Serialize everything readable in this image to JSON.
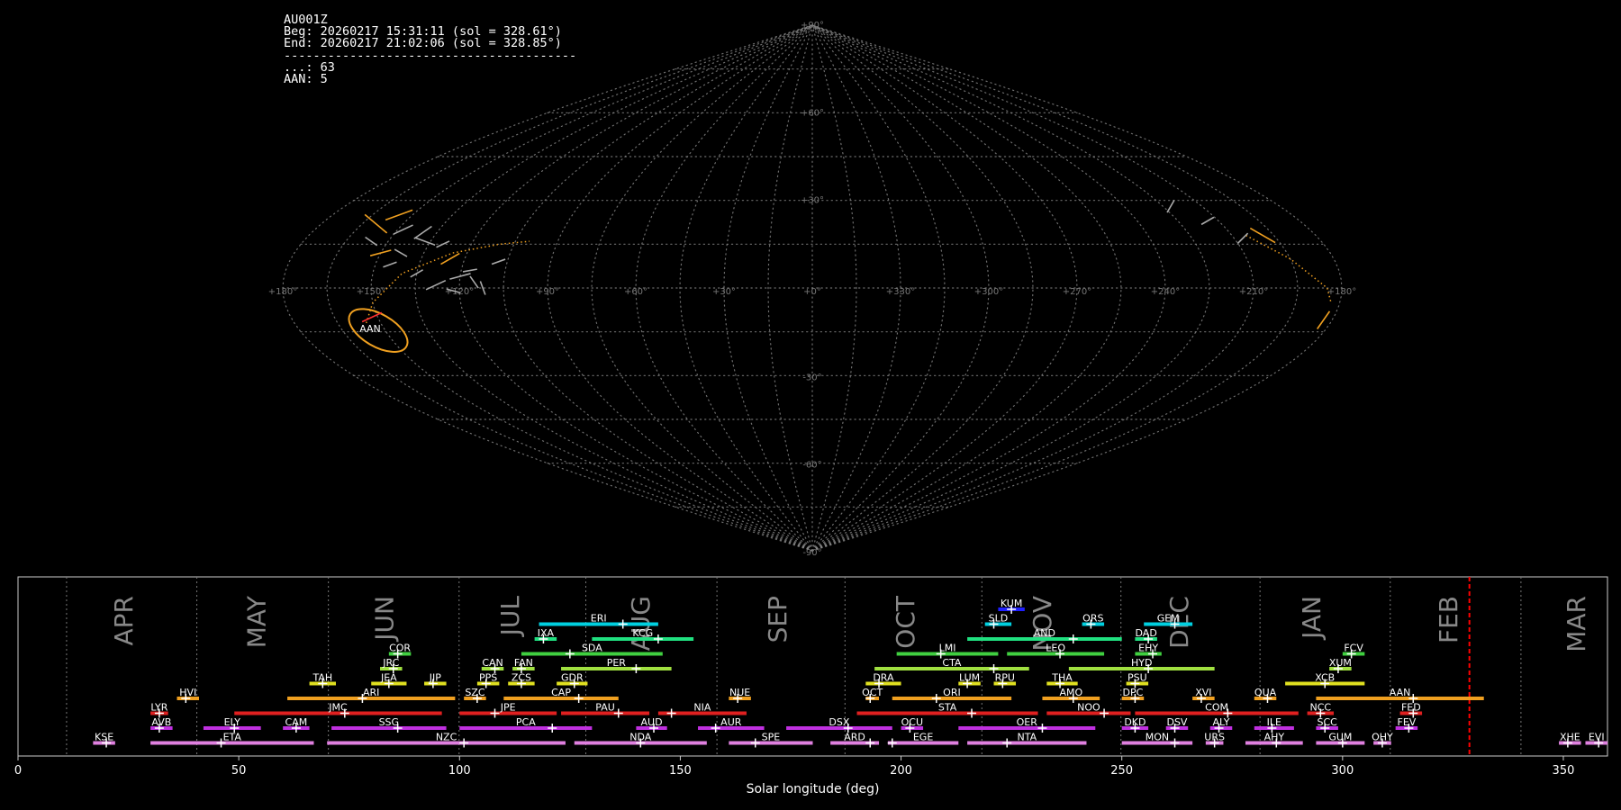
{
  "header": {
    "station": "AU001Z",
    "beg": "Beg: 20260217 15:31:11 (sol = 328.61°)",
    "end": "End: 20260217 21:02:06 (sol = 328.85°)",
    "divider": "----------------------------------------",
    "sporadic": "...: 63",
    "shower_count": "AAN: 5"
  },
  "colors": {
    "background": "#000000",
    "grid": "#888888",
    "orbit": "#f0a020",
    "sol_marker": "#ff0000"
  },
  "chart_data": [
    {
      "type": "scatter",
      "projection": "sinusoidal",
      "lon_labels": [
        "+180°",
        "+150°",
        "+120°",
        "+90°",
        "+60°",
        "+30°",
        "+0°",
        "+330°",
        "+300°",
        "+270°",
        "+240°",
        "+210°",
        "+180°"
      ],
      "lat_labels": [
        "+90°",
        "+60°",
        "+30°",
        "-30°",
        "-60°",
        "-90°"
      ],
      "annotations": [
        "AAN"
      ],
      "radiants": [
        {
          "lon": 155,
          "lat": 25,
          "len": 4,
          "ang": 20,
          "color": "#f0a020"
        },
        {
          "lon": 160,
          "lat": 22,
          "len": 4,
          "ang": -40,
          "color": "#f0a020"
        },
        {
          "lon": 150,
          "lat": 12,
          "len": 3,
          "ang": 15,
          "color": "#f0a020"
        },
        {
          "lon": 125,
          "lat": 10,
          "len": 3,
          "ang": 30,
          "color": "#f0a020"
        },
        {
          "lon": 148,
          "lat": 20,
          "len": 3,
          "ang": 25,
          "color": "#aaaaaa"
        },
        {
          "lon": 140,
          "lat": 19,
          "len": 3,
          "ang": 35,
          "color": "#aaaaaa"
        },
        {
          "lon": 137,
          "lat": 16,
          "len": 3,
          "ang": -20,
          "color": "#aaaaaa"
        },
        {
          "lon": 130,
          "lat": 15,
          "len": 2,
          "ang": 25,
          "color": "#aaaaaa"
        },
        {
          "lon": 156,
          "lat": 16,
          "len": 2,
          "ang": -35,
          "color": "#aaaaaa"
        },
        {
          "lon": 145,
          "lat": 8,
          "len": 2,
          "ang": 20,
          "color": "#aaaaaa"
        },
        {
          "lon": 120,
          "lat": 4,
          "len": 3,
          "ang": 15,
          "color": "#aaaaaa"
        },
        {
          "lon": 128,
          "lat": 1,
          "len": 3,
          "ang": 25,
          "color": "#aaaaaa"
        },
        {
          "lon": 122,
          "lat": -1,
          "len": 2,
          "ang": -15,
          "color": "#aaaaaa"
        },
        {
          "lon": 115,
          "lat": 2,
          "len": 2,
          "ang": -55,
          "color": "#aaaaaa"
        },
        {
          "lon": 135,
          "lat": 5,
          "len": 2,
          "ang": 30,
          "color": "#aaaaaa"
        },
        {
          "lon": 117,
          "lat": 6,
          "len": 2,
          "ang": 10,
          "color": "#aaaaaa"
        },
        {
          "lon": 112,
          "lat": 0,
          "len": 2,
          "ang": -70,
          "color": "#aaaaaa"
        },
        {
          "lon": 108,
          "lat": 9,
          "len": 2,
          "ang": 20,
          "color": "#aaaaaa"
        },
        {
          "lon": 143,
          "lat": 12,
          "len": 2,
          "ang": -30,
          "color": "#aaaaaa"
        },
        {
          "lon": 152,
          "lat": -10,
          "len": 3,
          "ang": 25,
          "color": "#ff3030"
        },
        {
          "lon": 199,
          "lat": 18,
          "len": 4,
          "ang": -30,
          "color": "#f0a020"
        },
        {
          "lon": 183,
          "lat": -11,
          "len": 3,
          "ang": 55,
          "color": "#f0a020"
        },
        {
          "lon": 207,
          "lat": 17,
          "len": 2,
          "ang": 45,
          "color": "#aaaaaa"
        },
        {
          "lon": 214,
          "lat": 23,
          "len": 2,
          "ang": 30,
          "color": "#aaaaaa"
        },
        {
          "lon": 222,
          "lat": 28,
          "len": 2,
          "ang": 60,
          "color": "#aaaaaa"
        }
      ]
    },
    {
      "type": "bar",
      "xlabel": "Solar longitude (deg)",
      "xlim": [
        0,
        360
      ],
      "xticks": [
        0,
        50,
        100,
        150,
        200,
        250,
        300,
        350
      ],
      "month_boundaries": [
        11,
        40.5,
        70.3,
        99.9,
        128.6,
        158.3,
        187.3,
        218.3,
        249.8,
        281.3,
        310.8,
        340.4
      ],
      "months": [
        {
          "label": "APR",
          "x": 24
        },
        {
          "label": "MAY",
          "x": 54
        },
        {
          "label": "JUN",
          "x": 83
        },
        {
          "label": "JUL",
          "x": 111.5
        },
        {
          "label": "AUG",
          "x": 141
        },
        {
          "label": "SEP",
          "x": 172
        },
        {
          "label": "OCT",
          "x": 201
        },
        {
          "label": "NOV",
          "x": 232
        },
        {
          "label": "DEC",
          "x": 263
        },
        {
          "label": "JAN",
          "x": 293
        },
        {
          "label": "FEB",
          "x": 324
        },
        {
          "label": "MAR",
          "x": 353
        }
      ],
      "current_sol": 328.73,
      "showers": [
        {
          "code": "KUM",
          "start": 222,
          "end": 228,
          "peak": 225,
          "row": 10,
          "color": "#2020ff"
        },
        {
          "code": "ERI",
          "start": 118,
          "end": 145,
          "peak": 137,
          "row": 9,
          "color": "#00d0e0"
        },
        {
          "code": "SLD",
          "start": 219,
          "end": 225,
          "peak": 221,
          "row": 9,
          "color": "#00d0e0"
        },
        {
          "code": "ORS",
          "start": 241,
          "end": 246,
          "peak": 243,
          "row": 9,
          "color": "#00d0e0"
        },
        {
          "code": "GEM",
          "start": 255,
          "end": 266,
          "peak": 262,
          "row": 9,
          "color": "#00d0e0"
        },
        {
          "code": "IXA",
          "start": 117,
          "end": 122,
          "peak": 119,
          "row": 8,
          "color": "#20e080"
        },
        {
          "code": "KCG",
          "start": 130,
          "end": 153,
          "peak": 145,
          "row": 8,
          "color": "#20e080"
        },
        {
          "code": "AND",
          "start": 215,
          "end": 250,
          "peak": 239,
          "row": 8,
          "color": "#20e080"
        },
        {
          "code": "DAD",
          "start": 253,
          "end": 258,
          "peak": 256,
          "row": 8,
          "color": "#20e080"
        },
        {
          "code": "COR",
          "start": 84,
          "end": 89,
          "peak": 86,
          "row": 7,
          "color": "#40d040"
        },
        {
          "code": "SDA",
          "start": 114,
          "end": 146,
          "peak": 125,
          "row": 7,
          "color": "#40d040"
        },
        {
          "code": "LMI",
          "start": 199,
          "end": 222,
          "peak": 209,
          "row": 7,
          "color": "#40d040"
        },
        {
          "code": "LEO",
          "start": 224,
          "end": 246,
          "peak": 236,
          "row": 7,
          "color": "#40d040"
        },
        {
          "code": "EHY",
          "start": 253,
          "end": 259,
          "peak": 257,
          "row": 7,
          "color": "#40d040"
        },
        {
          "code": "FCV",
          "start": 300,
          "end": 305,
          "peak": 302,
          "row": 7,
          "color": "#40d040"
        },
        {
          "code": "JRC",
          "start": 82,
          "end": 87,
          "peak": 85,
          "row": 6,
          "color": "#a0e040"
        },
        {
          "code": "CAN",
          "start": 105,
          "end": 110,
          "peak": 108,
          "row": 6,
          "color": "#a0e040"
        },
        {
          "code": "FAN",
          "start": 112,
          "end": 117,
          "peak": 114,
          "row": 6,
          "color": "#a0e040"
        },
        {
          "code": "PER",
          "start": 123,
          "end": 148,
          "peak": 140,
          "row": 6,
          "color": "#a0e040"
        },
        {
          "code": "CTA",
          "start": 194,
          "end": 229,
          "peak": 221,
          "row": 6,
          "color": "#a0e040"
        },
        {
          "code": "HYD",
          "start": 238,
          "end": 271,
          "peak": 256,
          "row": 6,
          "color": "#a0e040"
        },
        {
          "code": "XUM",
          "start": 297,
          "end": 302,
          "peak": 299,
          "row": 6,
          "color": "#a0e040"
        },
        {
          "code": "TAH",
          "start": 66,
          "end": 72,
          "peak": 69,
          "row": 5,
          "color": "#e0e020"
        },
        {
          "code": "JEA",
          "start": 80,
          "end": 88,
          "peak": 84,
          "row": 5,
          "color": "#e0e020"
        },
        {
          "code": "JIP",
          "start": 92,
          "end": 97,
          "peak": 94,
          "row": 5,
          "color": "#e0e020"
        },
        {
          "code": "PPS",
          "start": 104,
          "end": 109,
          "peak": 106,
          "row": 5,
          "color": "#e0e020"
        },
        {
          "code": "ZCS",
          "start": 111,
          "end": 117,
          "peak": 114,
          "row": 5,
          "color": "#e0e020"
        },
        {
          "code": "GDR",
          "start": 122,
          "end": 129,
          "peak": 126,
          "row": 5,
          "color": "#e0e020"
        },
        {
          "code": "DRA",
          "start": 192,
          "end": 200,
          "peak": 195,
          "row": 5,
          "color": "#e0e020"
        },
        {
          "code": "LUM",
          "start": 213,
          "end": 218,
          "peak": 215,
          "row": 5,
          "color": "#e0e020"
        },
        {
          "code": "RPU",
          "start": 221,
          "end": 226,
          "peak": 223,
          "row": 5,
          "color": "#e0e020"
        },
        {
          "code": "THA",
          "start": 233,
          "end": 240,
          "peak": 236,
          "row": 5,
          "color": "#e0e020"
        },
        {
          "code": "PSU",
          "start": 251,
          "end": 256,
          "peak": 253,
          "row": 5,
          "color": "#e0e020"
        },
        {
          "code": "XCB",
          "start": 287,
          "end": 305,
          "peak": 296,
          "row": 5,
          "color": "#e0e020"
        },
        {
          "code": "HVI",
          "start": 36,
          "end": 41,
          "peak": 38,
          "row": 4,
          "color": "#f0a020"
        },
        {
          "code": "ARI",
          "start": 61,
          "end": 99,
          "peak": 78,
          "row": 4,
          "color": "#f0a020"
        },
        {
          "code": "SZC",
          "start": 101,
          "end": 106,
          "peak": 104,
          "row": 4,
          "color": "#f0a020"
        },
        {
          "code": "CAP",
          "start": 110,
          "end": 136,
          "peak": 127,
          "row": 4,
          "color": "#f0a020"
        },
        {
          "code": "NUE",
          "start": 161,
          "end": 166,
          "peak": 163,
          "row": 4,
          "color": "#f0a020"
        },
        {
          "code": "OCT",
          "start": 192,
          "end": 195,
          "peak": 193,
          "row": 4,
          "color": "#f0a020"
        },
        {
          "code": "ORI",
          "start": 198,
          "end": 225,
          "peak": 208,
          "row": 4,
          "color": "#f0a020"
        },
        {
          "code": "AMO",
          "start": 232,
          "end": 245,
          "peak": 239,
          "row": 4,
          "color": "#f0a020"
        },
        {
          "code": "DPC",
          "start": 250,
          "end": 255,
          "peak": 253,
          "row": 4,
          "color": "#f0a020"
        },
        {
          "code": "XVI",
          "start": 266,
          "end": 271,
          "peak": 268,
          "row": 4,
          "color": "#f0a020"
        },
        {
          "code": "QUA",
          "start": 280,
          "end": 285,
          "peak": 283,
          "row": 4,
          "color": "#f0a020"
        },
        {
          "code": "AAN",
          "start": 294,
          "end": 332,
          "peak": 316,
          "row": 4,
          "color": "#f0a020"
        },
        {
          "code": "LYR",
          "start": 30,
          "end": 34,
          "peak": 32,
          "row": 3,
          "color": "#e02020"
        },
        {
          "code": "JMC",
          "start": 49,
          "end": 96,
          "peak": 74,
          "row": 3,
          "color": "#e02020"
        },
        {
          "code": "JPE",
          "start": 100,
          "end": 122,
          "peak": 108,
          "row": 3,
          "color": "#e02020"
        },
        {
          "code": "PAU",
          "start": 123,
          "end": 143,
          "peak": 136,
          "row": 3,
          "color": "#e02020"
        },
        {
          "code": "NIA",
          "start": 145,
          "end": 165,
          "peak": 148,
          "row": 3,
          "color": "#e02020"
        },
        {
          "code": "STA",
          "start": 190,
          "end": 231,
          "peak": 216,
          "row": 3,
          "color": "#e02020"
        },
        {
          "code": "NOO",
          "start": 233,
          "end": 252,
          "peak": 246,
          "row": 3,
          "color": "#e02020"
        },
        {
          "code": "COM",
          "start": 253,
          "end": 290,
          "peak": 274,
          "row": 3,
          "color": "#e02020"
        },
        {
          "code": "NCC",
          "start": 292,
          "end": 298,
          "peak": 295,
          "row": 3,
          "color": "#e02020"
        },
        {
          "code": "FED",
          "start": 313,
          "end": 318,
          "peak": 316,
          "row": 3,
          "color": "#e02020"
        },
        {
          "code": "AVB",
          "start": 30,
          "end": 35,
          "peak": 32,
          "row": 2,
          "color": "#c030e0"
        },
        {
          "code": "ELY",
          "start": 42,
          "end": 55,
          "peak": 49,
          "row": 2,
          "color": "#c030e0"
        },
        {
          "code": "CAM",
          "start": 60,
          "end": 66,
          "peak": 63,
          "row": 2,
          "color": "#c030e0"
        },
        {
          "code": "SSG",
          "start": 71,
          "end": 97,
          "peak": 86,
          "row": 2,
          "color": "#c030e0"
        },
        {
          "code": "PCA",
          "start": 100,
          "end": 130,
          "peak": 121,
          "row": 2,
          "color": "#c030e0"
        },
        {
          "code": "AUD",
          "start": 140,
          "end": 147,
          "peak": 144,
          "row": 2,
          "color": "#c030e0"
        },
        {
          "code": "AUR",
          "start": 154,
          "end": 169,
          "peak": 158,
          "row": 2,
          "color": "#c030e0"
        },
        {
          "code": "DSX",
          "start": 174,
          "end": 198,
          "peak": 188,
          "row": 2,
          "color": "#c030e0"
        },
        {
          "code": "OCU",
          "start": 200,
          "end": 205,
          "peak": 202,
          "row": 2,
          "color": "#c030e0"
        },
        {
          "code": "OER",
          "start": 213,
          "end": 244,
          "peak": 232,
          "row": 2,
          "color": "#c030e0"
        },
        {
          "code": "DKD",
          "start": 250,
          "end": 256,
          "peak": 253,
          "row": 2,
          "color": "#c030e0"
        },
        {
          "code": "DSV",
          "start": 260,
          "end": 265,
          "peak": 262,
          "row": 2,
          "color": "#c030e0"
        },
        {
          "code": "ALY",
          "start": 270,
          "end": 275,
          "peak": 272,
          "row": 2,
          "color": "#c030e0"
        },
        {
          "code": "ILE",
          "start": 280,
          "end": 289,
          "peak": 284,
          "row": 2,
          "color": "#c030e0"
        },
        {
          "code": "SCC",
          "start": 294,
          "end": 299,
          "peak": 296,
          "row": 2,
          "color": "#c030e0"
        },
        {
          "code": "FEV",
          "start": 312,
          "end": 317,
          "peak": 315,
          "row": 2,
          "color": "#c030e0"
        },
        {
          "code": "KSE",
          "start": 17,
          "end": 22,
          "peak": 20,
          "row": 1,
          "color": "#e080e0"
        },
        {
          "code": "ETA",
          "start": 30,
          "end": 67,
          "peak": 46,
          "row": 1,
          "color": "#e080e0"
        },
        {
          "code": "NZC",
          "start": 70,
          "end": 124,
          "peak": 101,
          "row": 1,
          "color": "#e080e0"
        },
        {
          "code": "NDA",
          "start": 126,
          "end": 156,
          "peak": 141,
          "row": 1,
          "color": "#e080e0"
        },
        {
          "code": "SPE",
          "start": 161,
          "end": 180,
          "peak": 167,
          "row": 1,
          "color": "#e080e0"
        },
        {
          "code": "ARD",
          "start": 184,
          "end": 195,
          "peak": 193,
          "row": 1,
          "color": "#e080e0"
        },
        {
          "code": "EGE",
          "start": 197,
          "end": 213,
          "peak": 198,
          "row": 1,
          "color": "#e080e0"
        },
        {
          "code": "NTA",
          "start": 215,
          "end": 242,
          "peak": 224,
          "row": 1,
          "color": "#e080e0"
        },
        {
          "code": "MON",
          "start": 250,
          "end": 266,
          "peak": 262,
          "row": 1,
          "color": "#e080e0"
        },
        {
          "code": "URS",
          "start": 269,
          "end": 273,
          "peak": 271,
          "row": 1,
          "color": "#e080e0"
        },
        {
          "code": "AHY",
          "start": 278,
          "end": 291,
          "peak": 285,
          "row": 1,
          "color": "#e080e0"
        },
        {
          "code": "GUM",
          "start": 294,
          "end": 305,
          "peak": 300,
          "row": 1,
          "color": "#e080e0"
        },
        {
          "code": "OHY",
          "start": 307,
          "end": 311,
          "peak": 309,
          "row": 1,
          "color": "#e080e0"
        },
        {
          "code": "XHE",
          "start": 349,
          "end": 354,
          "peak": 351,
          "row": 1,
          "color": "#e080e0"
        },
        {
          "code": "EVI",
          "start": 355,
          "end": 360,
          "peak": 358,
          "row": 1,
          "color": "#e080e0"
        }
      ]
    }
  ]
}
